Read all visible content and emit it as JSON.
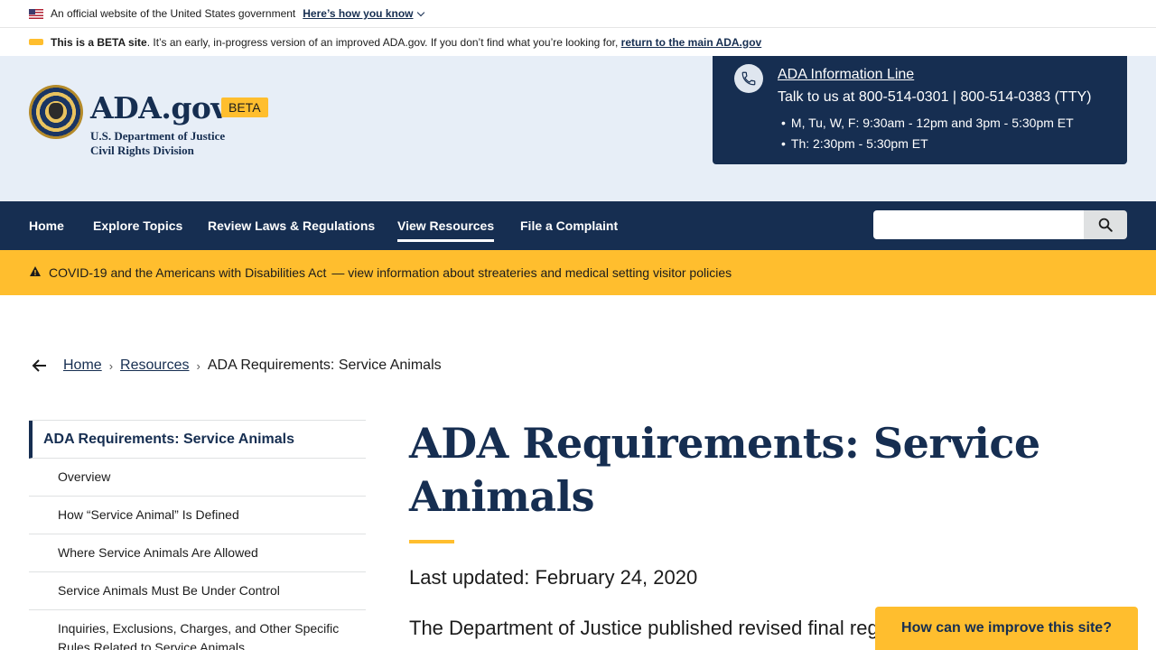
{
  "gov_banner": {
    "text": "An official website of the United States government",
    "link": "Here’s how you know"
  },
  "beta_banner": {
    "bold": "This is a BETA site",
    "text": ". It’s an early, in-progress version of an improved ADA.gov. If you don’t find what you’re looking for,",
    "link": "return to the main ADA.gov"
  },
  "header": {
    "logo_title": "ADA.gov",
    "beta_badge": "BETA",
    "dept_line1": "U.S. Department of Justice",
    "dept_line2": "Civil Rights Division"
  },
  "info_line": {
    "title": "ADA Information Line",
    "talk": "Talk to us at 800-514-0301 | 800-514-0383 (TTY)",
    "hours": [
      "M, Tu, W, F: 9:30am - 12pm and 3pm - 5:30pm ET",
      "Th: 2:30pm - 5:30pm ET"
    ]
  },
  "nav": {
    "items": [
      "Home",
      "Explore Topics",
      "Review Laws & Regulations",
      "View Resources",
      "File a Complaint"
    ],
    "active": "View Resources",
    "search_placeholder": ""
  },
  "alert": {
    "text": "COVID-19 and the Americans with Disabilities Act",
    "link": "— view information about streateries and medical setting visitor policies"
  },
  "breadcrumb": {
    "items": [
      "Home",
      "Resources"
    ],
    "current": "ADA Requirements: Service Animals"
  },
  "sidenav": {
    "current": "ADA Requirements: Service Animals",
    "items": [
      "Overview",
      "How “Service Animal” Is Defined",
      "Where Service Animals Are Allowed",
      "Service Animals Must Be Under Control",
      "Inquiries, Exclusions, Charges, and Other Specific Rules Related to Service Animals"
    ]
  },
  "main": {
    "title": "ADA Requirements: Service Animals",
    "updated": "Last updated: February 24, 2020",
    "lead": "The Department of Justice published revised final regulations"
  },
  "feedback": {
    "label": "How can we improve this site?"
  },
  "colors": {
    "navy": "#162e51",
    "gold": "#ffbe2e",
    "header_bg": "#e7eef7"
  }
}
